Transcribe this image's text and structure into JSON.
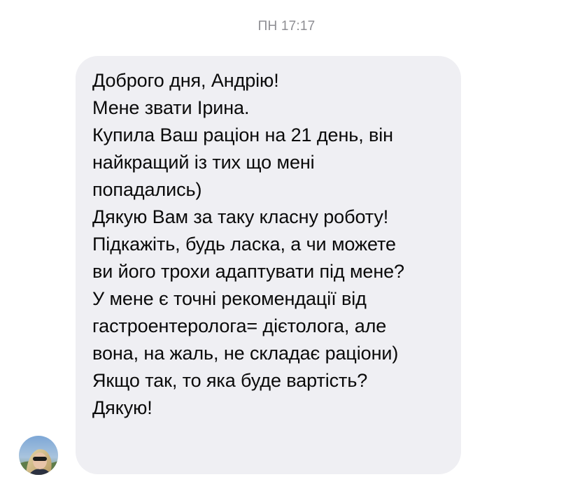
{
  "chat": {
    "timestamp": "ПН 17:17",
    "message": {
      "lines": [
        "Доброго дня, Андрію!",
        "Мене звати Ірина.",
        "Купила Ваш раціон на 21 день, він",
        "найкращий із тих що мені",
        "попадались)",
        "Дякую Вам за таку класну роботу!",
        "Підкажіть, будь ласка, а чи можете",
        "ви його трохи адаптувати під мене?",
        "У мене є точні рекомендації від",
        "гастроентеролога= дієтолога, але",
        "вона, на жаль, не складає раціони)",
        "Якщо так, то яка буде вартість?",
        "Дякую!"
      ]
    },
    "sender": {
      "avatar_icon": "user-photo-avatar"
    }
  },
  "colors": {
    "bubble_background": "#efeff3",
    "timestamp_text": "#8e8e93",
    "message_text": "#0a0a0a"
  }
}
